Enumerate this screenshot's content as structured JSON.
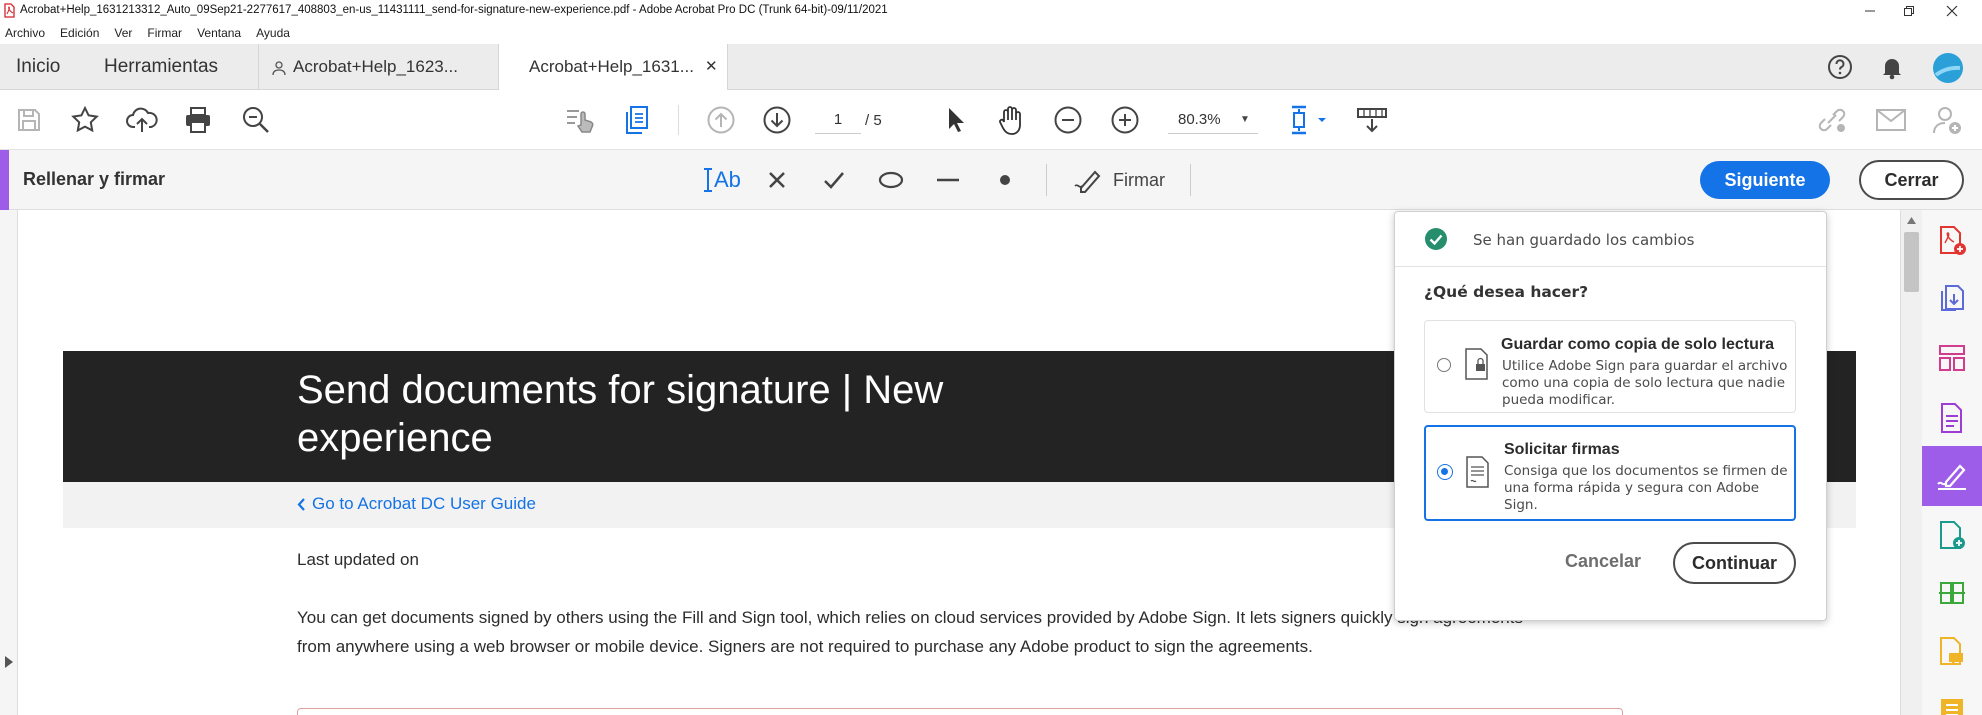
{
  "window": {
    "title": "Acrobat+Help_1631213312_Auto_09Sep21-2277617_408803_en-us_11431111_send-for-signature-new-experience.pdf - Adobe Acrobat Pro DC (Trunk 64-bit)-09/11/2021"
  },
  "menu": [
    "Archivo",
    "Edición",
    "Ver",
    "Firmar",
    "Ventana",
    "Ayuda"
  ],
  "nav": {
    "home": "Inicio",
    "tools": "Herramientas"
  },
  "tabs": [
    {
      "label": "Acrobat+Help_1623...",
      "active": false
    },
    {
      "label": "Acrobat+Help_1631...",
      "active": true
    }
  ],
  "toolbar": {
    "page_current": "1",
    "page_total": "/ 5",
    "zoom": "80.3%"
  },
  "fill_sign": {
    "label": "Rellenar y firmar",
    "text_tool": "Ab",
    "sign_label": "Firmar",
    "next": "Siguiente",
    "close": "Cerrar",
    "color": "#000000"
  },
  "document": {
    "title": "Send documents for signature | New experience",
    "back_link": "Go to Acrobat DC User Guide",
    "updated": "Last updated on",
    "para_line1": "You can get documents signed by others using the Fill and Sign tool, which relies on cloud services provided by Adobe Sign. It lets signers quickly sign agreements",
    "para_line2": "from anywhere using a web browser or mobile device. Signers are not required to purchase any Adobe product to sign the agreements."
  },
  "popup": {
    "saved": "Se han guardado los cambios",
    "question": "¿Qué desea hacer?",
    "options": [
      {
        "title": "Guardar como copia de solo lectura",
        "desc": "Utilice Adobe Sign para guardar el archivo como una copia de solo lectura que nadie pueda modificar.",
        "selected": false
      },
      {
        "title": "Solicitar firmas",
        "desc": "Consiga que los documentos se firmen de una forma rápida y segura con Adobe Sign.",
        "selected": true
      }
    ],
    "cancel": "Cancelar",
    "continue": "Continuar"
  },
  "colors": {
    "accent": "#1473e6",
    "fill_sign_accent": "#9e5de8",
    "banner": "#232323"
  }
}
